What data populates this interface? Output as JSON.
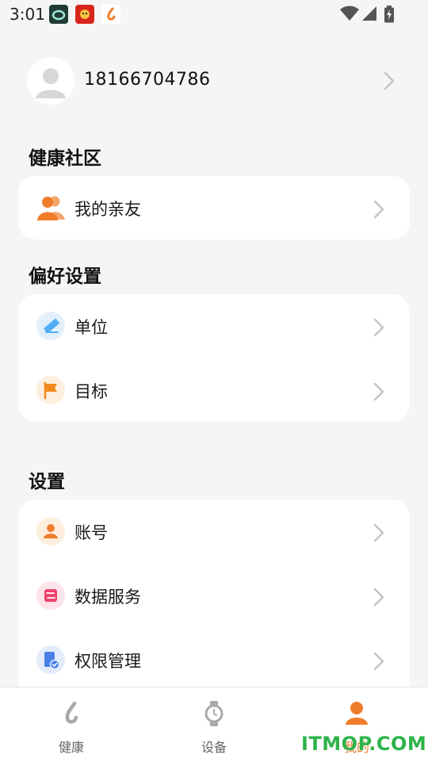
{
  "status_bar": {
    "time": "3:01",
    "notification_icons": [
      "app-icon-ring",
      "app-icon-red",
      "app-icon-health"
    ],
    "system_icons": [
      "wifi-icon",
      "signal-icon",
      "battery-charging-icon"
    ]
  },
  "profile": {
    "phone": "18166704786",
    "avatar_icon": "default-avatar-icon"
  },
  "sections": {
    "community": {
      "title": "健康社区",
      "items": [
        {
          "label": "我的亲友",
          "icon": "friends-icon"
        }
      ]
    },
    "preferences": {
      "title": "偏好设置",
      "items": [
        {
          "label": "单位",
          "icon": "ruler-icon"
        },
        {
          "label": "目标",
          "icon": "flag-icon"
        }
      ]
    },
    "settings": {
      "title": "设置",
      "items": [
        {
          "label": "账号",
          "icon": "account-icon"
        },
        {
          "label": "数据服务",
          "icon": "data-service-icon"
        },
        {
          "label": "权限管理",
          "icon": "permission-icon"
        }
      ]
    }
  },
  "bottom_nav": {
    "tabs": [
      {
        "label": "健康",
        "icon": "health-icon"
      },
      {
        "label": "设备",
        "icon": "watch-icon"
      },
      {
        "label": "我的",
        "icon": "me-icon",
        "active": true
      }
    ]
  },
  "watermark": "ITMOP.COM",
  "colors": {
    "accent": "#f07d2b",
    "background": "#f5f5f5",
    "card": "#ffffff"
  }
}
